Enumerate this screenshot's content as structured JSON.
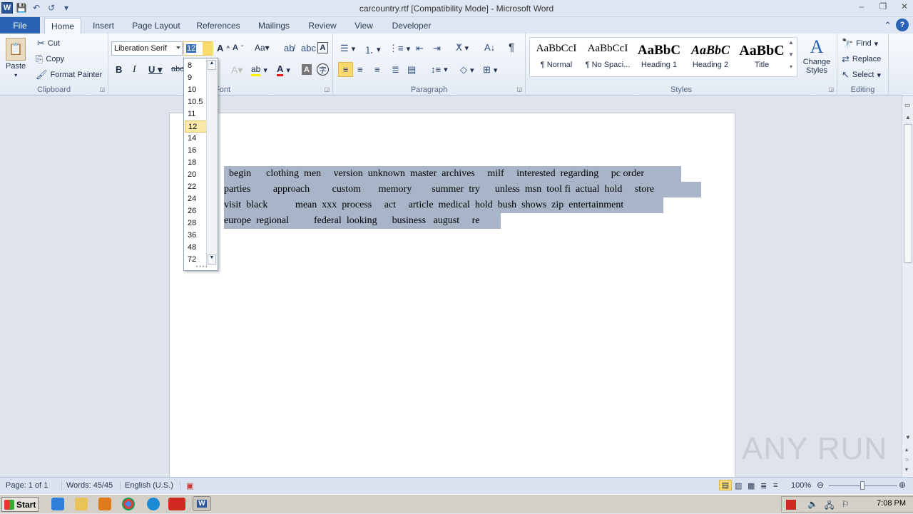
{
  "window": {
    "title": "carcountry.rtf [Compatibility Mode]  -  Microsoft Word",
    "controls": [
      "–",
      "❐",
      "✕"
    ],
    "logo": "W"
  },
  "qat": {
    "save": "💾",
    "undo": "↶",
    "redo": "↺",
    "more": "▾"
  },
  "tabs": [
    {
      "label": "File"
    },
    {
      "label": "Home"
    },
    {
      "label": "Insert"
    },
    {
      "label": "Page Layout"
    },
    {
      "label": "References"
    },
    {
      "label": "Mailings"
    },
    {
      "label": "Review"
    },
    {
      "label": "View"
    },
    {
      "label": "Developer"
    }
  ],
  "clipboard": {
    "paste": "Paste",
    "cut": "Cut",
    "copy": "Copy",
    "format_painter": "Format Painter",
    "label": "Clipboard"
  },
  "font": {
    "name": "Liberation Serif",
    "size": "12",
    "label": "Font"
  },
  "paragraph": {
    "label": "Paragraph"
  },
  "styles": {
    "label": "Styles",
    "items": [
      {
        "preview": "AaBbCcI",
        "name": "¶ Normal"
      },
      {
        "preview": "AaBbCcI",
        "name": "¶ No Spaci..."
      },
      {
        "preview": "AaBbC",
        "name": "Heading 1"
      },
      {
        "preview": "AaBbC",
        "name": "Heading 2"
      },
      {
        "preview": "AaBbC",
        "name": "Title"
      }
    ],
    "change": "Change Styles"
  },
  "editing": {
    "label": "Editing",
    "find": "Find",
    "replace": "Replace",
    "select": "Select"
  },
  "font_sizes": [
    "8",
    "9",
    "10",
    "10.5",
    "11",
    "12",
    "14",
    "16",
    "18",
    "20",
    "22",
    "24",
    "26",
    "28",
    "36",
    "48",
    "72"
  ],
  "selected_size": "12",
  "document": {
    "lines": [
      "  begin      clothing  men     version  unknown  master  archives     milf     interested  regarding     pc order",
      "parties         approach         custom       memory        summer  try      unless  msn  tool fi  actual  hold     store",
      "visit  black           mean  xxx  process     act     article  medical  hold  bush  shows  zip  entertainment",
      "europe  regional          federal  looking      business   august     re"
    ]
  },
  "status": {
    "page": "Page: 1 of 1",
    "words": "Words: 45/45",
    "language": "English (U.S.)",
    "zoom": "100%"
  },
  "taskbar": {
    "start": "Start",
    "clock": "7:08 PM"
  },
  "watermark": "ANY RUN"
}
